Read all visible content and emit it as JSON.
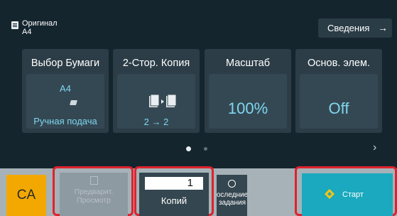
{
  "header": {
    "original_label": "Оригинал",
    "original_size": "A4",
    "details_button": "Сведения",
    "details_arrow": "→",
    "doc_icon": "document-icon"
  },
  "tiles": [
    {
      "title": "Выбор Бумаги",
      "size": "A4",
      "tray_icon": "paper-tray-icon",
      "source": "Ручная подача"
    },
    {
      "title": "2-Стор. Копия",
      "duplex_icon": "duplex-copy-icon",
      "mode": "2 → 2"
    },
    {
      "title": "Масштаб",
      "value": "100%"
    },
    {
      "title": "Основ. элем.",
      "value": "Off"
    }
  ],
  "pager": {
    "current_page": 1,
    "total_pages": 2,
    "next_icon": "chevron-right-icon",
    "next_glyph": "›"
  },
  "bottom": {
    "ca_label": "CA",
    "preview_label_1": "Предварит.",
    "preview_label_2": "Просмотр",
    "copies_value": "1",
    "copies_label": "Копий",
    "recent_label_1": "оследние",
    "recent_label_2": "задания",
    "start_label": "Старт"
  },
  "colors": {
    "background": "#14252e",
    "tile": "#2c3d47",
    "accent_text": "#7fd7ef",
    "ca_button": "#f2a800",
    "start_button": "#1aa9be",
    "highlight": "#e0212c"
  }
}
